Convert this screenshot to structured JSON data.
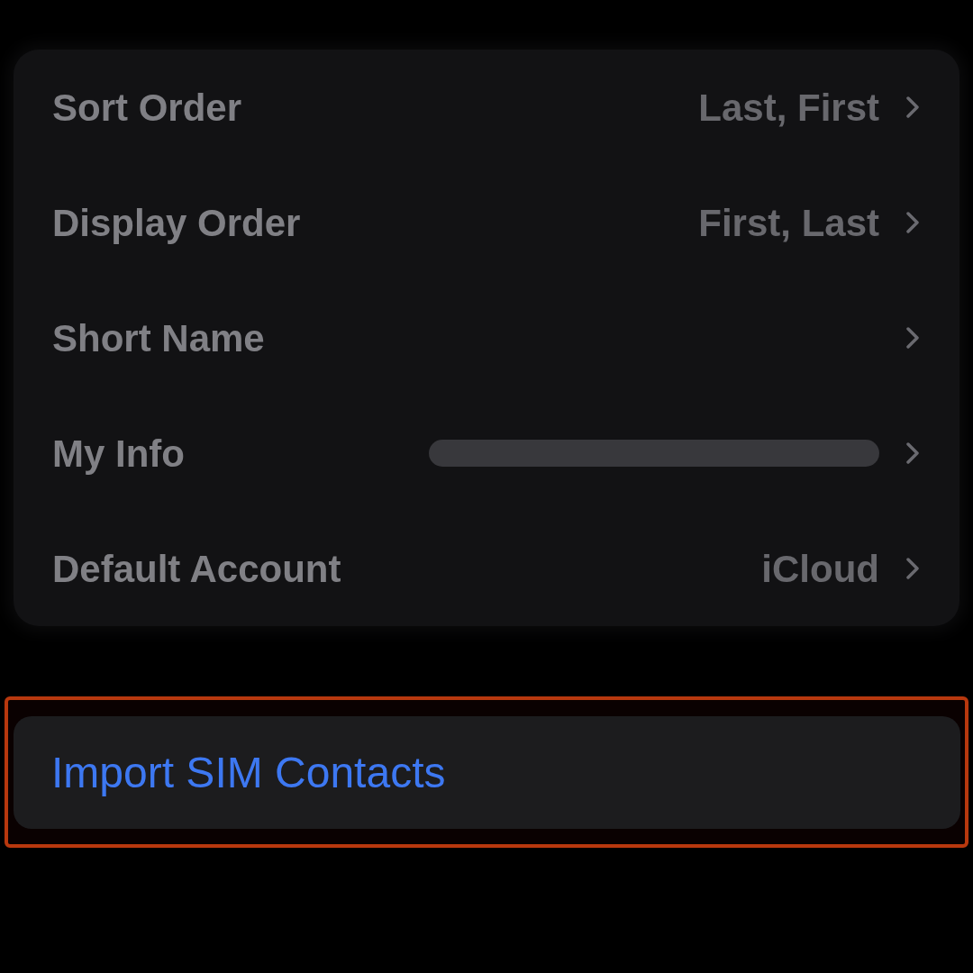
{
  "settings": {
    "rows": [
      {
        "label": "Sort Order",
        "value": "Last, First"
      },
      {
        "label": "Display Order",
        "value": "First, Last"
      },
      {
        "label": "Short Name"
      },
      {
        "label": "My Info",
        "value_redacted": true
      },
      {
        "label": "Default Account",
        "value": "iCloud"
      }
    ]
  },
  "import_button": {
    "label": "Import SIM Contacts",
    "highlighted": true
  }
}
